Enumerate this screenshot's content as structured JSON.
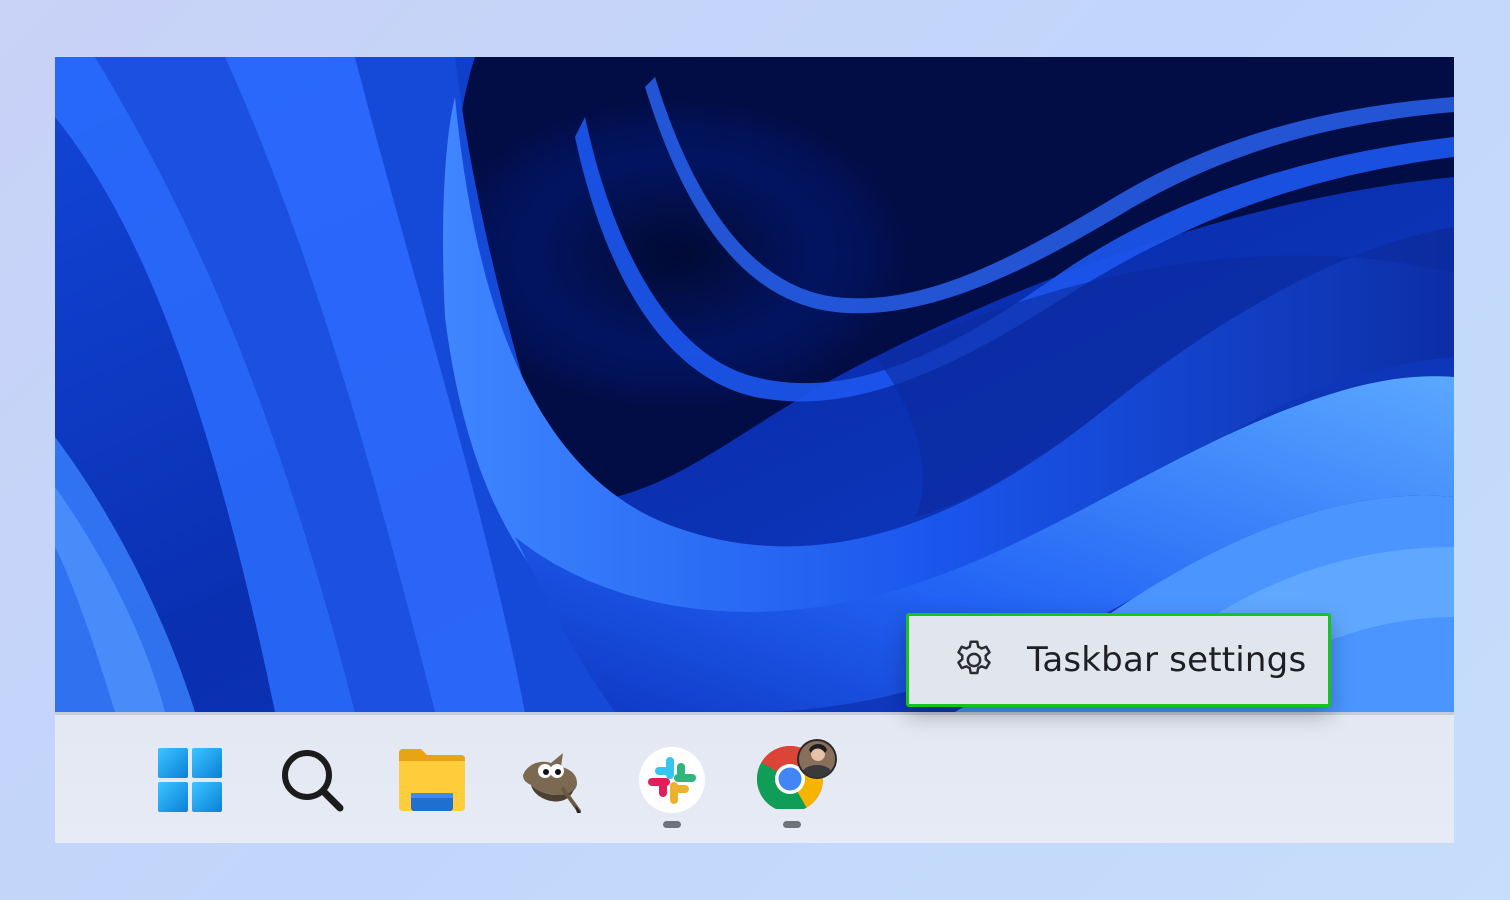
{
  "context_menu": {
    "items": [
      {
        "label": "Taskbar settings",
        "icon": "gear-icon"
      }
    ],
    "highlight_color": "#18c41a"
  },
  "taskbar": {
    "apps": [
      {
        "name": "Start",
        "icon": "windows-start-icon",
        "running": false
      },
      {
        "name": "Search",
        "icon": "search-icon",
        "running": false
      },
      {
        "name": "File Explorer",
        "icon": "folder-icon",
        "running": false
      },
      {
        "name": "GIMP",
        "icon": "gimp-icon",
        "running": false
      },
      {
        "name": "Slack",
        "icon": "slack-icon",
        "running": true
      },
      {
        "name": "Google Chrome",
        "icon": "chrome-icon",
        "running": true
      }
    ]
  },
  "wallpaper": {
    "theme": "Windows 11 Bloom",
    "colors": [
      "#0a1a6b",
      "#0d3bd6",
      "#2a6bff",
      "#4aa0ff"
    ]
  }
}
